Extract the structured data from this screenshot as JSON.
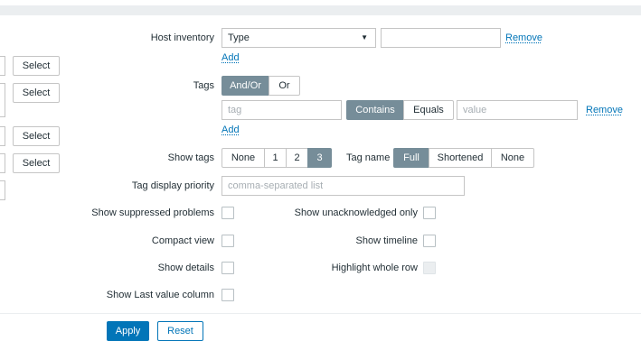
{
  "left_column": {
    "select_label": "Select"
  },
  "host_inventory": {
    "label": "Host inventory",
    "type_value": "Type",
    "value": "",
    "remove_label": "Remove",
    "add_label": "Add",
    "dropdown_icon": "triangle-down"
  },
  "tags": {
    "label": "Tags",
    "operator_options": [
      "And/Or",
      "Or"
    ],
    "operator_selected": "And/Or",
    "tag_placeholder": "tag",
    "condition_options": [
      "Contains",
      "Equals"
    ],
    "condition_selected": "Contains",
    "value_placeholder": "value",
    "remove_label": "Remove",
    "add_label": "Add"
  },
  "show_tags": {
    "label": "Show tags",
    "options": [
      "None",
      "1",
      "2",
      "3"
    ],
    "selected": "3",
    "tag_name_label": "Tag name",
    "tag_name_options": [
      "Full",
      "Shortened",
      "None"
    ],
    "tag_name_selected": "Full"
  },
  "tag_display_priority": {
    "label": "Tag display priority",
    "placeholder": "comma-separated list"
  },
  "checkboxes": {
    "show_suppressed": {
      "label": "Show suppressed problems",
      "checked": false
    },
    "compact_view": {
      "label": "Compact view",
      "checked": false
    },
    "show_details": {
      "label": "Show details",
      "checked": false
    },
    "show_last_value": {
      "label": "Show Last value column",
      "checked": false
    },
    "show_unacknowledged": {
      "label": "Show unacknowledged only",
      "checked": false
    },
    "show_timeline": {
      "label": "Show timeline",
      "checked": false
    },
    "highlight_row": {
      "label": "Highlight whole row",
      "checked": false,
      "disabled": true
    }
  },
  "actions": {
    "apply_label": "Apply",
    "reset_label": "Reset"
  },
  "colors": {
    "accent": "#0275b8",
    "segment_active": "#768d99",
    "border": "#c5c5c5"
  }
}
